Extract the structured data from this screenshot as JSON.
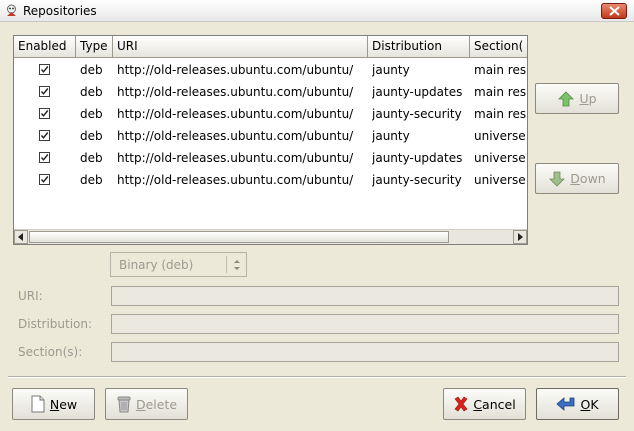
{
  "window": {
    "title": "Repositories"
  },
  "table": {
    "columns": [
      "Enabled",
      "Type",
      "URI",
      "Distribution",
      "Section("
    ],
    "rows": [
      {
        "enabled": true,
        "type": "deb",
        "uri": "http://old-releases.ubuntu.com/ubuntu/",
        "distribution": "jaunty",
        "section": "main res"
      },
      {
        "enabled": true,
        "type": "deb",
        "uri": "http://old-releases.ubuntu.com/ubuntu/",
        "distribution": "jaunty-updates",
        "section": "main res"
      },
      {
        "enabled": true,
        "type": "deb",
        "uri": "http://old-releases.ubuntu.com/ubuntu/",
        "distribution": "jaunty-security",
        "section": "main res"
      },
      {
        "enabled": true,
        "type": "deb",
        "uri": "http://old-releases.ubuntu.com/ubuntu/",
        "distribution": "jaunty",
        "section": "universe"
      },
      {
        "enabled": true,
        "type": "deb",
        "uri": "http://old-releases.ubuntu.com/ubuntu/",
        "distribution": "jaunty-updates",
        "section": "universe"
      },
      {
        "enabled": true,
        "type": "deb",
        "uri": "http://old-releases.ubuntu.com/ubuntu/",
        "distribution": "jaunty-security",
        "section": "universe"
      }
    ]
  },
  "buttons": {
    "up_mnemonic": "U",
    "up_rest": "p",
    "down_mnemonic": "D",
    "down_rest": "own",
    "new_mnemonic": "N",
    "new_rest": "ew",
    "delete_mnemonic": "D",
    "delete_rest": "elete",
    "cancel_mnemonic": "C",
    "cancel_rest": "ancel",
    "ok_mnemonic": "O",
    "ok_rest": "K"
  },
  "form": {
    "type_select": "Binary (deb)",
    "uri_label": "URI:",
    "distribution_label": "Distribution:",
    "sections_label": "Section(s):",
    "uri_value": "",
    "distribution_value": "",
    "sections_value": ""
  },
  "icons": {
    "window": "app-icon",
    "close": "close-icon",
    "up": "arrow-up-icon",
    "down": "arrow-down-icon",
    "new": "new-document-icon",
    "delete": "trash-icon",
    "cancel": "cancel-x-icon",
    "ok": "ok-return-icon"
  },
  "colors": {
    "up_arrow": "#7cc26a",
    "down_arrow": "#9fbf8a",
    "cancel_x": "#d8231b",
    "ok_arrow": "#3a6fc4"
  }
}
